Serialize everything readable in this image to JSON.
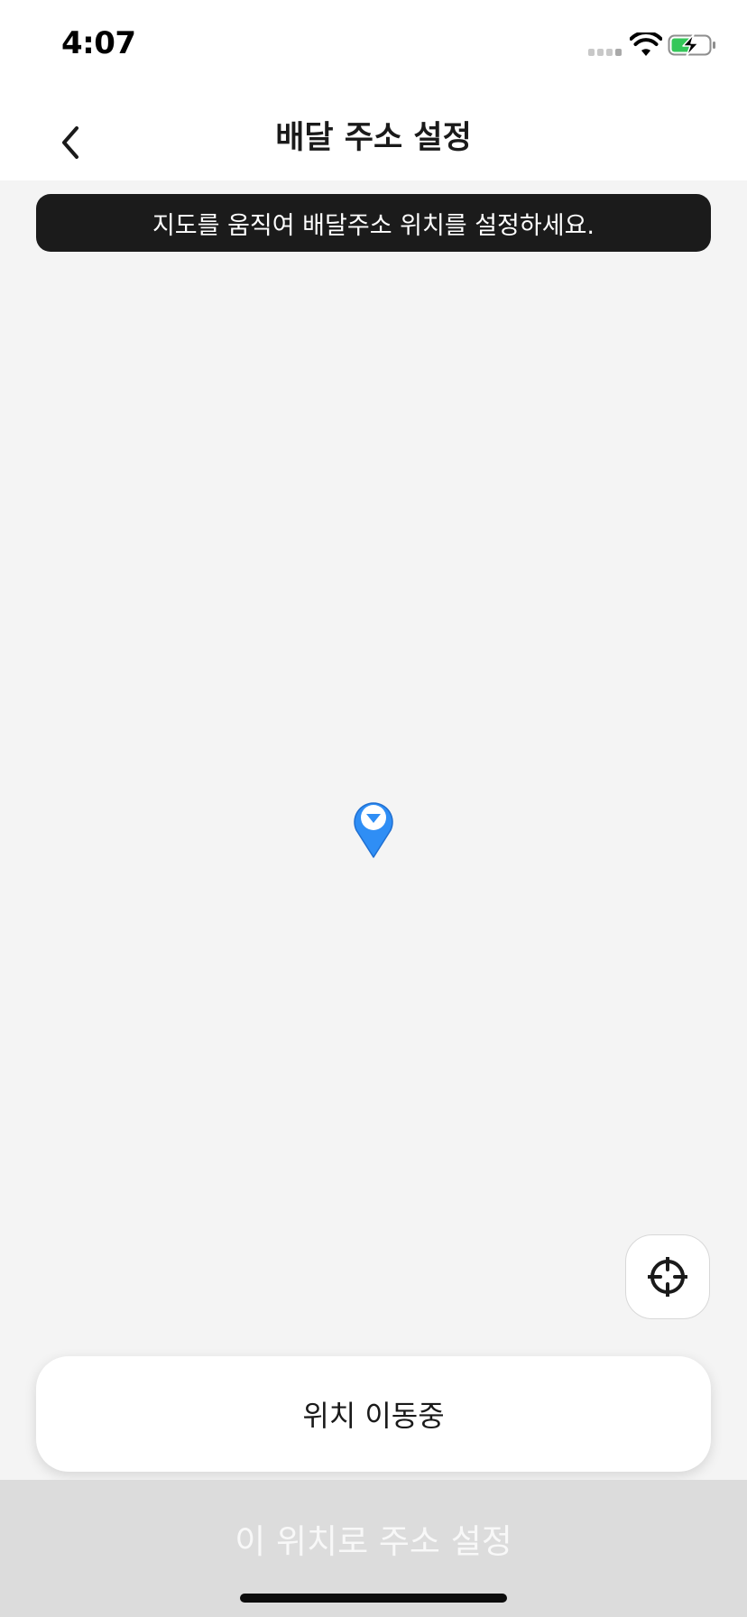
{
  "status_bar": {
    "time": "4:07",
    "signal_icon": "cellular-signal-icon",
    "wifi_icon": "wifi-icon",
    "battery_icon": "battery-charging-icon",
    "battery_color": "#34c759"
  },
  "header": {
    "title": "배달 주소 설정",
    "back_icon": "chevron-left-icon"
  },
  "map": {
    "hint": "지도를 움직여 배달주소 위치를 설정하세요.",
    "pin_icon": "map-pin-icon",
    "pin_color": "#2f8ef5",
    "locate_icon": "crosshair-icon"
  },
  "location_status": {
    "text": "위치 이동중"
  },
  "footer": {
    "confirm_label": "이 위치로 주소 설정",
    "confirm_enabled": false
  }
}
